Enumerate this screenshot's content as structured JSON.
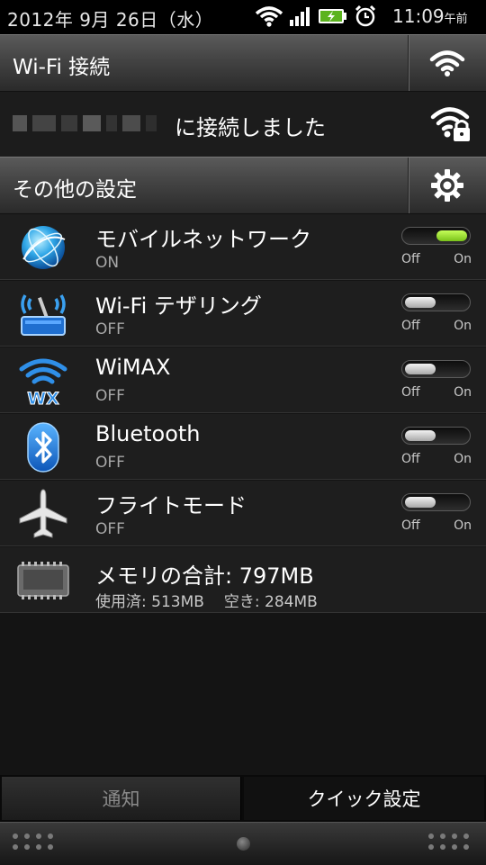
{
  "status_bar": {
    "date": "2012年 9月 26日（水）",
    "time": "11:09",
    "ampm": "午前"
  },
  "wifi_header": {
    "label": "Wi-Fi 接続"
  },
  "wifi_connection": {
    "message": "に接続しました"
  },
  "settings_header": {
    "label": "その他の設定"
  },
  "toggles": [
    {
      "title": "モバイルネットワーク",
      "state": "ON",
      "on": true,
      "icon": "globe-icon"
    },
    {
      "title": "Wi-Fi テザリング",
      "state": "OFF",
      "on": false,
      "icon": "tethering-router-icon"
    },
    {
      "title": "WiMAX",
      "state": "OFF",
      "on": false,
      "icon": "wimax-icon"
    },
    {
      "title": "Bluetooth",
      "state": "OFF",
      "on": false,
      "icon": "bluetooth-icon"
    },
    {
      "title": "フライトモード",
      "state": "OFF",
      "on": false,
      "icon": "airplane-icon"
    }
  ],
  "toggle_labels": {
    "off": "Off",
    "on": "On"
  },
  "memory": {
    "title": "メモリの合計: 797MB",
    "used": "使用済: 513MB",
    "free": "空き: 284MB"
  },
  "tabs": [
    {
      "label": "通知",
      "active": false
    },
    {
      "label": "クイック設定",
      "active": true
    }
  ],
  "colors": {
    "toggle_on": "#8ed62a",
    "toggle_off": "#c8c8c8"
  }
}
